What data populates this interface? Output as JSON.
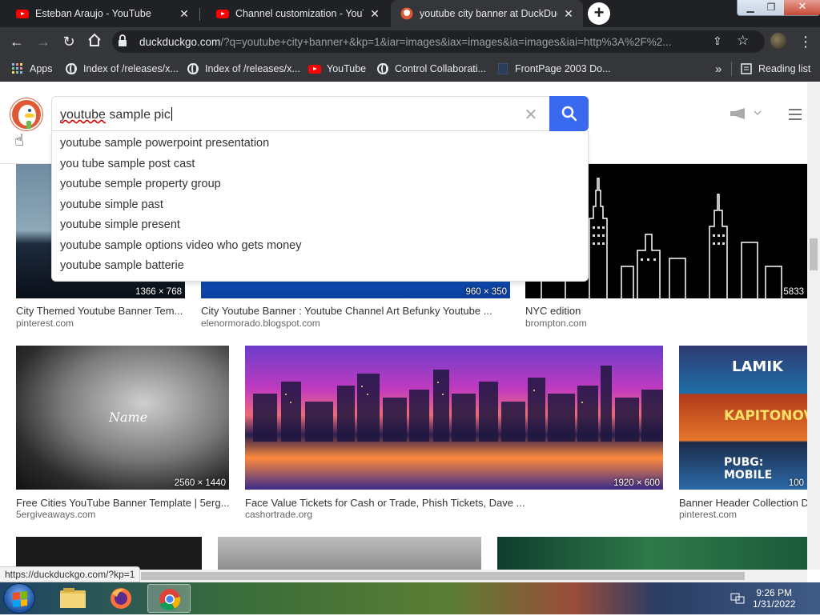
{
  "browser": {
    "tabs": [
      {
        "title": "Esteban Araujo - YouTube",
        "icon": "youtube-icon",
        "active": false
      },
      {
        "title": "Channel customization - YouTube",
        "icon": "youtube-icon",
        "active": false
      },
      {
        "title": "youtube city banner at DuckDuckGo",
        "icon": "duckduckgo-icon",
        "active": true
      }
    ],
    "new_tab": "+",
    "url_host": "duckduckgo.com",
    "url_rest": "/?q=youtube+city+banner+&kp=1&iar=images&iax=images&ia=images&iai=http%3A%2F%2...",
    "bookmarks": [
      {
        "label": "Apps",
        "icon": "apps-grid-icon"
      },
      {
        "label": "Index of /releases/x...",
        "icon": "globe-icon"
      },
      {
        "label": "Index of /releases/x...",
        "icon": "globe-icon"
      },
      {
        "label": "YouTube",
        "icon": "youtube-icon"
      },
      {
        "label": "Control Collaborati...",
        "icon": "globe-icon"
      },
      {
        "label": "FrontPage 2003 Do...",
        "icon": "page-icon"
      }
    ],
    "more_bookmarks": "»",
    "reading_list": "Reading list",
    "status_url": "https://duckduckgo.com/?kp=1"
  },
  "search": {
    "query_misspelled": "youtube",
    "query_rest": " sample pic",
    "suggestions": [
      "youtube sample powerpoint presentation",
      "you tube sample post cast",
      "youtube semple property group",
      "youtube simple past",
      "youtube simple present",
      "youtube sample options video who gets money",
      "youtube sample batterie"
    ]
  },
  "results": [
    {
      "caption": "City Themed Youtube Banner Tem...",
      "source": "pinterest.com",
      "resolution": "1366 × 768"
    },
    {
      "caption": "City Youtube Banner : Youtube Channel Art Befunky Youtube ...",
      "source": "elenormorado.blogspot.com",
      "resolution": "960 × 350"
    },
    {
      "caption": "NYC edition",
      "source": "brompton.com",
      "resolution": "5833"
    },
    {
      "caption": "Free Cities YouTube Banner Template | 5erg...",
      "source": "5ergiveaways.com",
      "resolution": "2560 × 1440",
      "overlay": "Name"
    },
    {
      "caption": "Face Value Tickets for Cash or Trade, Phish Tickets, Dave ...",
      "source": "cashortrade.org",
      "resolution": "1920 × 600"
    },
    {
      "caption": "Banner Header Collection D",
      "source": "pinterest.com",
      "resolution": "100",
      "overlay_lines": [
        "LAMIK",
        "KAPITONOV",
        "PUBG: MOBILE"
      ]
    }
  ],
  "taskbar": {
    "time": "9:26 PM",
    "date": "1/31/2022"
  },
  "colors": {
    "ddg_blue": "#3969ef",
    "ddg_orange": "#de5833",
    "chrome_dark": "#202124"
  }
}
